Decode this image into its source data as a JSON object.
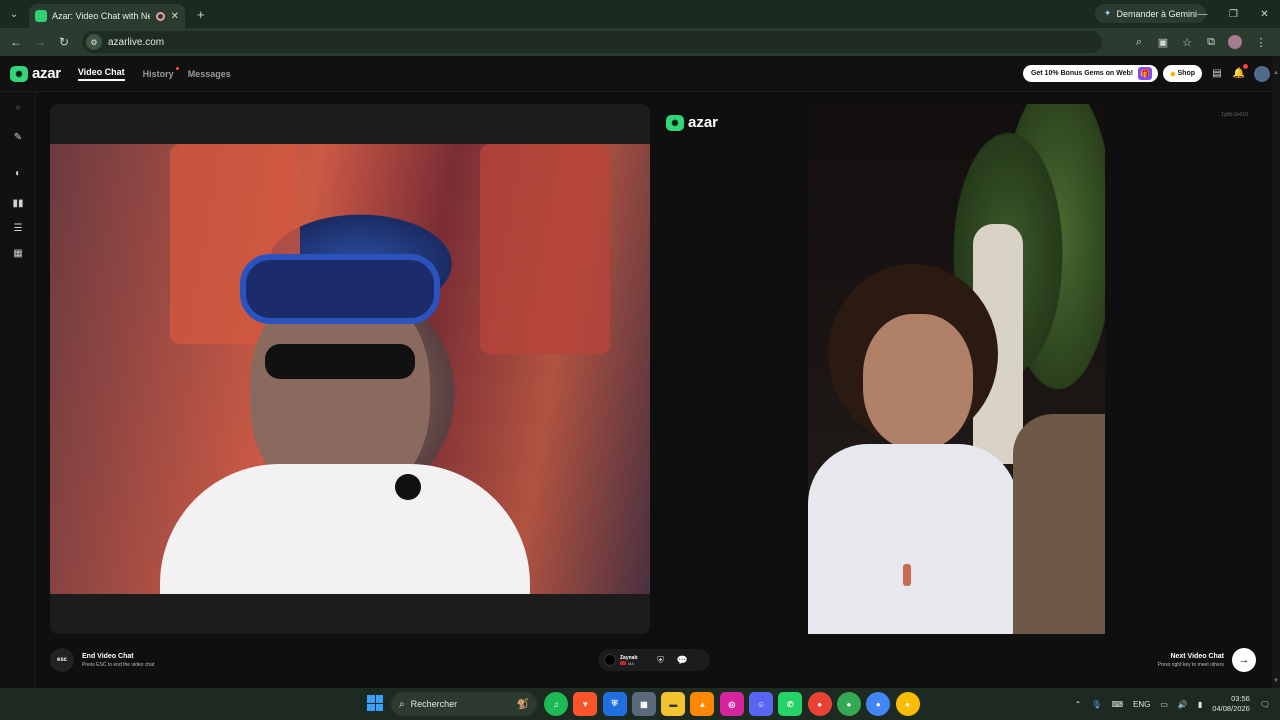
{
  "browser": {
    "tab_title": "Azar: Video Chat with New",
    "new_tab_icon": "plus-icon",
    "gemini_label": "Demander à Gemini",
    "url": "azarlive.com"
  },
  "app": {
    "logo_text": "azar",
    "nav": {
      "video_chat": "Video Chat",
      "history": "History",
      "messages": "Messages"
    },
    "promo_label": "Get 10% Bonus Gems on Web!",
    "shop_label": "Shop",
    "watermark_text": "azar",
    "peer_id_text": "1g9b-2e010"
  },
  "controls": {
    "esc_badge": "esc",
    "end_title": "End Video Chat",
    "end_hint": "Press ESC to end the video chat",
    "peer_name": "Zaynab",
    "peer_country": "MA",
    "next_title": "Next Video Chat",
    "next_hint": "Press right key to meet others"
  },
  "taskbar": {
    "search_placeholder": "Rechercher",
    "tray_lang": "ENG",
    "time": "03:56",
    "date": "04/08/2026"
  },
  "colors": {
    "accent_green": "#32d67a",
    "browser_chrome": "#2b3b2f",
    "notification_red": "#ff3b3b"
  }
}
